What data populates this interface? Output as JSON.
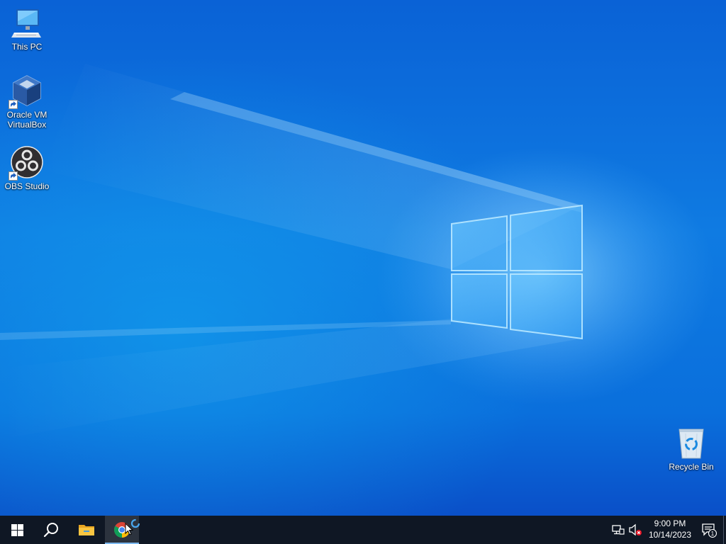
{
  "desktop": {
    "icons": [
      {
        "label": "This PC",
        "icon": "this-pc-icon"
      },
      {
        "label": "Oracle VM\nVirtualBox",
        "icon": "virtualbox-icon"
      },
      {
        "label": "OBS Studio",
        "icon": "obs-studio-icon"
      },
      {
        "label": "Recycle Bin",
        "icon": "recycle-bin-icon"
      }
    ]
  },
  "taskbar": {
    "start": {
      "icon": "windows-logo-icon"
    },
    "search": {
      "icon": "search-icon"
    },
    "pinned": [
      {
        "name": "File Explorer",
        "icon": "folder-icon"
      },
      {
        "name": "Google Chrome",
        "icon": "chrome-icon",
        "active": true
      }
    ],
    "tray": {
      "network_icon": "network-disconnected-icon",
      "volume_icon": "volume-muted-icon",
      "time": "9:00 PM",
      "date": "10/14/2023",
      "notification_icon": "action-center-icon",
      "notification_count": "1"
    }
  },
  "colors": {
    "taskbar": "#0f1724",
    "desktop_top": "#0a62d6",
    "desktop_mid": "#0f7be2",
    "accent": "#7db9f0"
  }
}
